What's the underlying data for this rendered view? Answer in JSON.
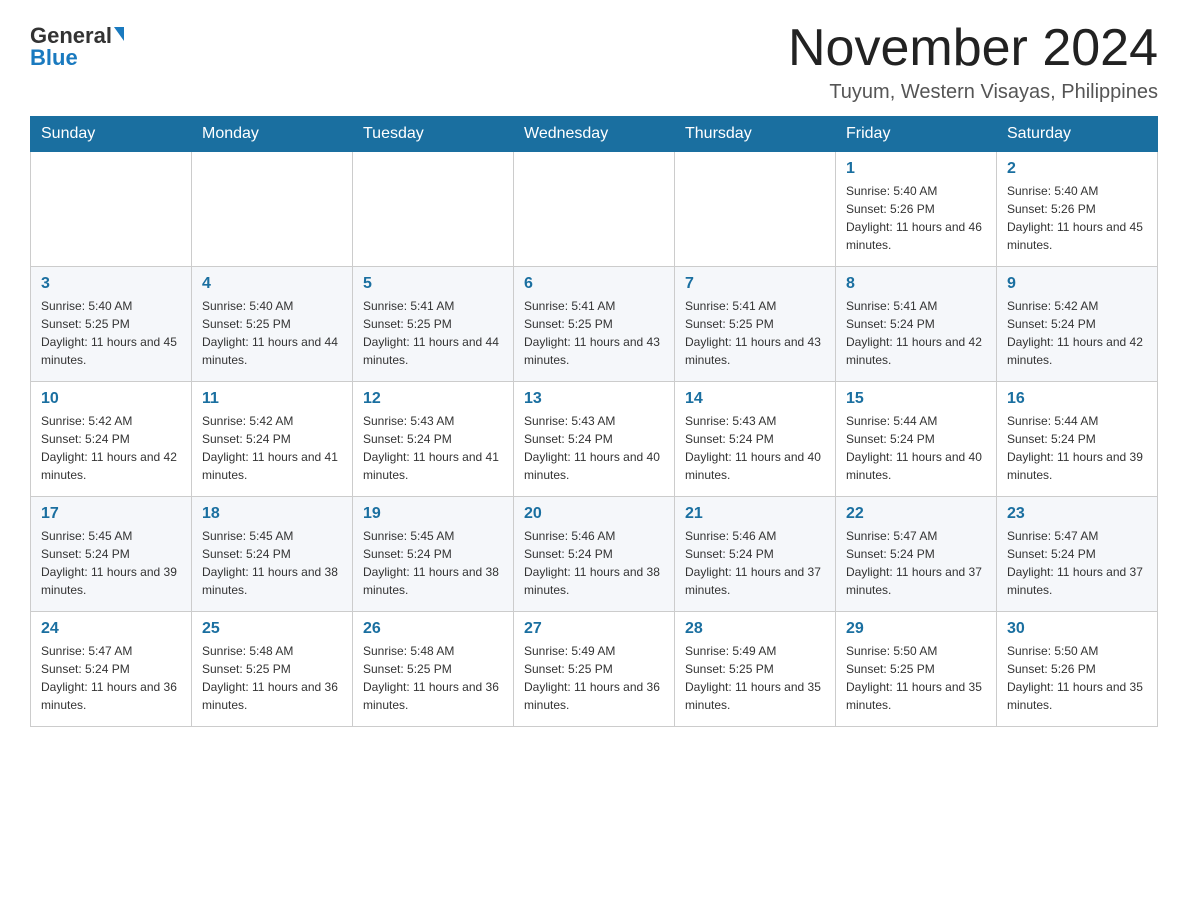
{
  "header": {
    "logo": {
      "general": "General",
      "blue": "Blue"
    },
    "title": "November 2024",
    "location": "Tuyum, Western Visayas, Philippines"
  },
  "days_of_week": [
    "Sunday",
    "Monday",
    "Tuesday",
    "Wednesday",
    "Thursday",
    "Friday",
    "Saturday"
  ],
  "weeks": [
    [
      {
        "day": "",
        "info": ""
      },
      {
        "day": "",
        "info": ""
      },
      {
        "day": "",
        "info": ""
      },
      {
        "day": "",
        "info": ""
      },
      {
        "day": "",
        "info": ""
      },
      {
        "day": "1",
        "info": "Sunrise: 5:40 AM\nSunset: 5:26 PM\nDaylight: 11 hours and 46 minutes."
      },
      {
        "day": "2",
        "info": "Sunrise: 5:40 AM\nSunset: 5:26 PM\nDaylight: 11 hours and 45 minutes."
      }
    ],
    [
      {
        "day": "3",
        "info": "Sunrise: 5:40 AM\nSunset: 5:25 PM\nDaylight: 11 hours and 45 minutes."
      },
      {
        "day": "4",
        "info": "Sunrise: 5:40 AM\nSunset: 5:25 PM\nDaylight: 11 hours and 44 minutes."
      },
      {
        "day": "5",
        "info": "Sunrise: 5:41 AM\nSunset: 5:25 PM\nDaylight: 11 hours and 44 minutes."
      },
      {
        "day": "6",
        "info": "Sunrise: 5:41 AM\nSunset: 5:25 PM\nDaylight: 11 hours and 43 minutes."
      },
      {
        "day": "7",
        "info": "Sunrise: 5:41 AM\nSunset: 5:25 PM\nDaylight: 11 hours and 43 minutes."
      },
      {
        "day": "8",
        "info": "Sunrise: 5:41 AM\nSunset: 5:24 PM\nDaylight: 11 hours and 42 minutes."
      },
      {
        "day": "9",
        "info": "Sunrise: 5:42 AM\nSunset: 5:24 PM\nDaylight: 11 hours and 42 minutes."
      }
    ],
    [
      {
        "day": "10",
        "info": "Sunrise: 5:42 AM\nSunset: 5:24 PM\nDaylight: 11 hours and 42 minutes."
      },
      {
        "day": "11",
        "info": "Sunrise: 5:42 AM\nSunset: 5:24 PM\nDaylight: 11 hours and 41 minutes."
      },
      {
        "day": "12",
        "info": "Sunrise: 5:43 AM\nSunset: 5:24 PM\nDaylight: 11 hours and 41 minutes."
      },
      {
        "day": "13",
        "info": "Sunrise: 5:43 AM\nSunset: 5:24 PM\nDaylight: 11 hours and 40 minutes."
      },
      {
        "day": "14",
        "info": "Sunrise: 5:43 AM\nSunset: 5:24 PM\nDaylight: 11 hours and 40 minutes."
      },
      {
        "day": "15",
        "info": "Sunrise: 5:44 AM\nSunset: 5:24 PM\nDaylight: 11 hours and 40 minutes."
      },
      {
        "day": "16",
        "info": "Sunrise: 5:44 AM\nSunset: 5:24 PM\nDaylight: 11 hours and 39 minutes."
      }
    ],
    [
      {
        "day": "17",
        "info": "Sunrise: 5:45 AM\nSunset: 5:24 PM\nDaylight: 11 hours and 39 minutes."
      },
      {
        "day": "18",
        "info": "Sunrise: 5:45 AM\nSunset: 5:24 PM\nDaylight: 11 hours and 38 minutes."
      },
      {
        "day": "19",
        "info": "Sunrise: 5:45 AM\nSunset: 5:24 PM\nDaylight: 11 hours and 38 minutes."
      },
      {
        "day": "20",
        "info": "Sunrise: 5:46 AM\nSunset: 5:24 PM\nDaylight: 11 hours and 38 minutes."
      },
      {
        "day": "21",
        "info": "Sunrise: 5:46 AM\nSunset: 5:24 PM\nDaylight: 11 hours and 37 minutes."
      },
      {
        "day": "22",
        "info": "Sunrise: 5:47 AM\nSunset: 5:24 PM\nDaylight: 11 hours and 37 minutes."
      },
      {
        "day": "23",
        "info": "Sunrise: 5:47 AM\nSunset: 5:24 PM\nDaylight: 11 hours and 37 minutes."
      }
    ],
    [
      {
        "day": "24",
        "info": "Sunrise: 5:47 AM\nSunset: 5:24 PM\nDaylight: 11 hours and 36 minutes."
      },
      {
        "day": "25",
        "info": "Sunrise: 5:48 AM\nSunset: 5:25 PM\nDaylight: 11 hours and 36 minutes."
      },
      {
        "day": "26",
        "info": "Sunrise: 5:48 AM\nSunset: 5:25 PM\nDaylight: 11 hours and 36 minutes."
      },
      {
        "day": "27",
        "info": "Sunrise: 5:49 AM\nSunset: 5:25 PM\nDaylight: 11 hours and 36 minutes."
      },
      {
        "day": "28",
        "info": "Sunrise: 5:49 AM\nSunset: 5:25 PM\nDaylight: 11 hours and 35 minutes."
      },
      {
        "day": "29",
        "info": "Sunrise: 5:50 AM\nSunset: 5:25 PM\nDaylight: 11 hours and 35 minutes."
      },
      {
        "day": "30",
        "info": "Sunrise: 5:50 AM\nSunset: 5:26 PM\nDaylight: 11 hours and 35 minutes."
      }
    ]
  ]
}
